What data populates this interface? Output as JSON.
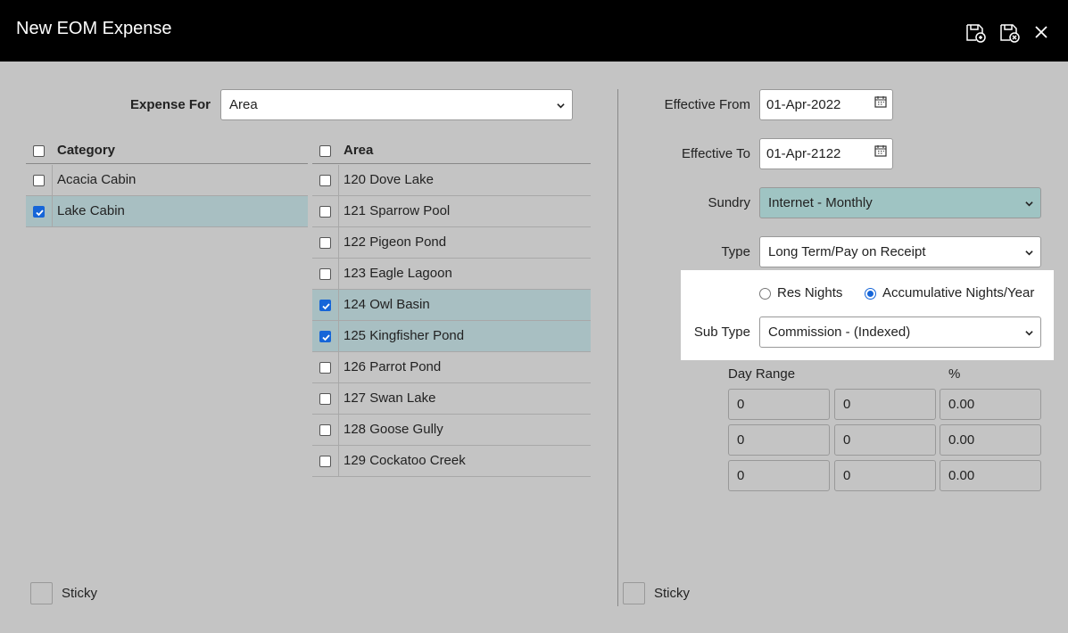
{
  "window": {
    "title": "New EOM Expense"
  },
  "expense_for": {
    "label": "Expense For",
    "value": "Area"
  },
  "category": {
    "header": "Category",
    "items": [
      {
        "label": "Acacia Cabin",
        "checked": false
      },
      {
        "label": "Lake Cabin",
        "checked": true
      }
    ]
  },
  "area": {
    "header": "Area",
    "items": [
      {
        "label": "120 Dove Lake",
        "checked": false
      },
      {
        "label": "121 Sparrow Pool",
        "checked": false
      },
      {
        "label": "122 Pigeon Pond",
        "checked": false
      },
      {
        "label": "123 Eagle Lagoon",
        "checked": false
      },
      {
        "label": "124 Owl Basin",
        "checked": true
      },
      {
        "label": "125 Kingfisher Pond",
        "checked": true
      },
      {
        "label": "126 Parrot Pond",
        "checked": false
      },
      {
        "label": "127 Swan Lake",
        "checked": false
      },
      {
        "label": "128 Goose Gully",
        "checked": false
      },
      {
        "label": "129 Cockatoo Creek",
        "checked": false
      }
    ]
  },
  "effective_from": {
    "label": "Effective From",
    "value": "01-Apr-2022"
  },
  "effective_to": {
    "label": "Effective To",
    "value": "01-Apr-2122"
  },
  "sundry": {
    "label": "Sundry",
    "value": "Internet - Monthly"
  },
  "type": {
    "label": "Type",
    "value": "Long Term/Pay on Receipt"
  },
  "nights_option": {
    "res_nights": "Res Nights",
    "accumulative": "Accumulative Nights/Year",
    "selected": "accumulative"
  },
  "sub_type": {
    "label": "Sub Type",
    "value": "Commission - (Indexed)"
  },
  "ranges": {
    "day_range_label": "Day Range",
    "percent_label": "%",
    "rows": [
      {
        "from": "0",
        "to": "0",
        "percent": "0.00"
      },
      {
        "from": "0",
        "to": "0",
        "percent": "0.00"
      },
      {
        "from": "0",
        "to": "0",
        "percent": "0.00"
      }
    ]
  },
  "sticky_left": {
    "label": "Sticky"
  },
  "sticky_right": {
    "label": "Sticky"
  },
  "colors": {
    "titlebar": "#000000",
    "background": "#c4c4c4",
    "selected_row": "#a8bfc2",
    "sundry_select": "#9fc4c3",
    "accent": "#1565d8"
  },
  "icons": [
    "save-icon",
    "save-close-icon",
    "close-icon",
    "calendar-icon",
    "chevron-down-icon"
  ]
}
